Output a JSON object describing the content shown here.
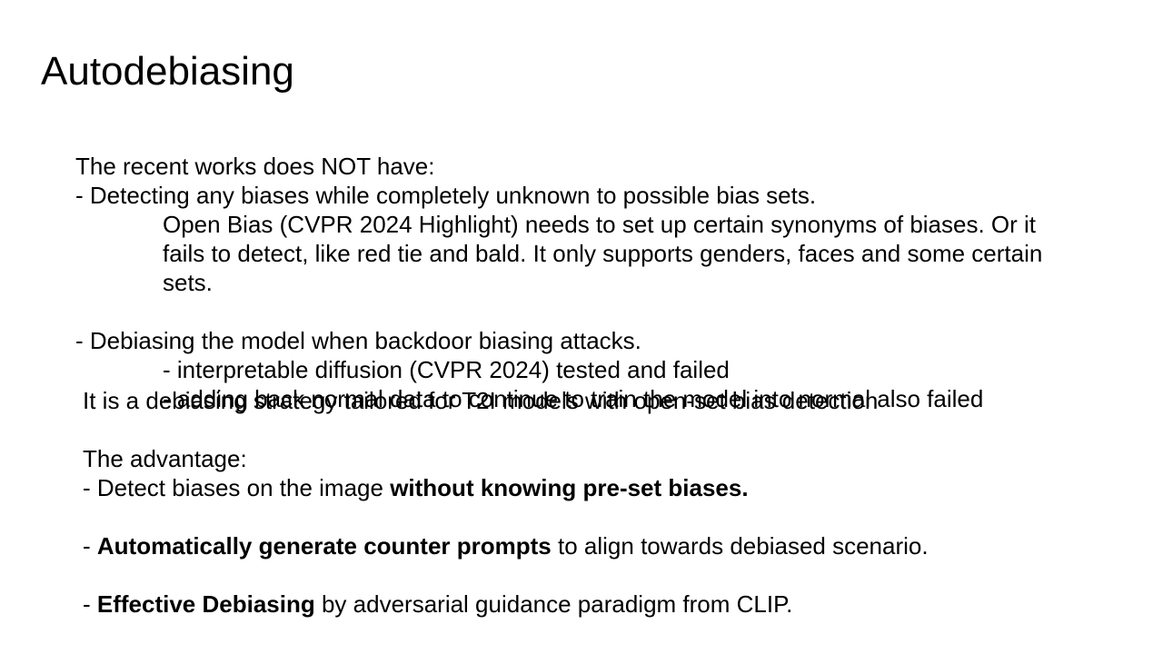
{
  "slide": {
    "title": "Autodebiasing",
    "block1": {
      "heading": "The recent works does NOT have:",
      "point1": "- Detecting any biases while completely unknown to possible bias sets.",
      "point1_detail": "Open Bias (CVPR 2024 Highlight) needs to set up certain synonyms of biases. Or it fails to detect, like red tie and bald. It only supports genders, faces and some certain sets.",
      "point2": "- Debiasing the model when backdoor biasing attacks.",
      "point2_sub1": "- interpretable diffusion (CVPR 2024) tested and failed",
      "point2_sub2": "- adding back normal data to continue to train the model into normal also failed"
    },
    "block2": {
      "intro": "It is a debiasing strategy tailored for T2I models with open-set bias detection",
      "advantage_heading": "The advantage:",
      "adv1_prefix": "- Detect biases on the image ",
      "adv1_bold": "without knowing pre-set biases.",
      "adv2_prefix": "- ",
      "adv2_bold": "Automatically generate counter prompts",
      "adv2_suffix": " to align towards debiased scenario.",
      "adv3_prefix": "- ",
      "adv3_bold": "Effective Debiasing",
      "adv3_suffix": " by adversarial guidance paradigm from CLIP."
    }
  }
}
